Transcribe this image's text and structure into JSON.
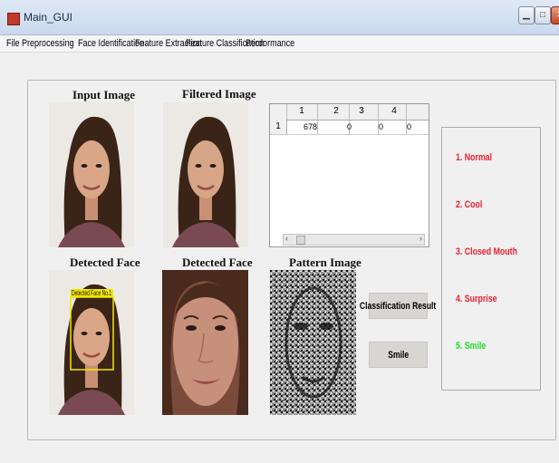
{
  "window": {
    "title": "Main_GUI"
  },
  "menu": [
    "File",
    "Preprocessing",
    "Face Identification",
    "Feature Extraction",
    "Feature Classification",
    "Perdormance"
  ],
  "panel": {
    "labels": {
      "input_image": "Input Image",
      "filtered_image": "Filtered Image",
      "detected_face_1": "Detected Face",
      "detected_face_2": "Detected Face",
      "pattern_image": "Pattern Image"
    },
    "detection_box_label": "Detected Face No.1"
  },
  "table": {
    "columns": [
      "1",
      "2",
      "3",
      "4"
    ],
    "rows": [
      {
        "header": "1",
        "cells": [
          "678",
          "0",
          "0",
          "0"
        ]
      }
    ]
  },
  "buttons": {
    "classification": "Classification Result",
    "smile": "Smile"
  },
  "results": {
    "items": [
      {
        "label": "1. Normal",
        "color": "#ee1c2e"
      },
      {
        "label": "2. Cool",
        "color": "#ee1c2e"
      },
      {
        "label": "3. Closed Mouth",
        "color": "#ee1c2e"
      },
      {
        "label": "4. Surprise",
        "color": "#ee1c2e"
      },
      {
        "label": "5. Smile",
        "color": "#22dd22"
      }
    ]
  }
}
